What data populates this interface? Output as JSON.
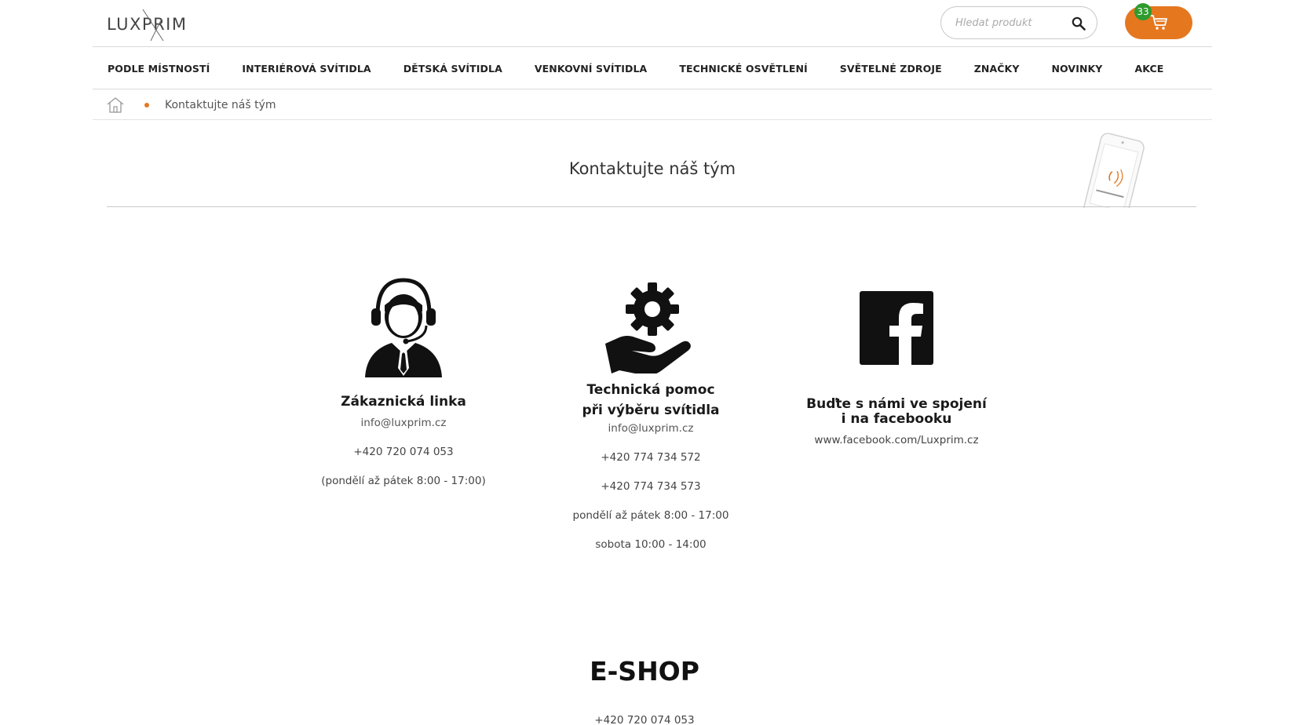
{
  "header": {
    "logo_text": "LUXPRIM",
    "search_placeholder": "Hledat produkt",
    "cart_count": "33"
  },
  "nav": {
    "items": [
      "PODLE MÍSTNOSTÍ",
      "INTERIÉROVÁ SVÍTIDLA",
      "DĚTSKÁ SVÍTIDLA",
      "VENKOVNÍ SVÍTIDLA",
      "TECHNICKÉ OSVĚTLENÍ",
      "SVĚTELNÉ ZDROJE",
      "ZNAČKY",
      "NOVINKY",
      "AKCE"
    ]
  },
  "breadcrumb": {
    "current": "Kontaktujte náš tým"
  },
  "page_title": "Kontaktujte náš tým",
  "contacts": [
    {
      "title": "Zákaznická linka",
      "icon": "support-agent-icon",
      "email": "info@luxprim.cz",
      "lines": [
        "+420 720 074 053",
        "(pondělí až pátek 8:00 - 17:00)"
      ]
    },
    {
      "title_line1": "Technická pomoc",
      "title_line2": "při výběru svítidla",
      "icon": "gear-hand-icon",
      "email": "info@luxprim.cz",
      "lines": [
        "+420 774 734 572",
        "+420 774 734 573",
        "pondělí až pátek 8:00 - 17:00",
        "sobota 10:00 - 14:00"
      ]
    },
    {
      "title_line1": "Buďte s námi ve spojení",
      "title_line2": "i na facebooku",
      "icon": "facebook-icon",
      "link": "www.facebook.com/Luxprim.cz"
    }
  ],
  "eshop": {
    "title": "E-SHOP",
    "phone": "+420 720 074 053"
  },
  "colors": {
    "accent": "#e5771f",
    "badge": "#2e9b2e"
  }
}
